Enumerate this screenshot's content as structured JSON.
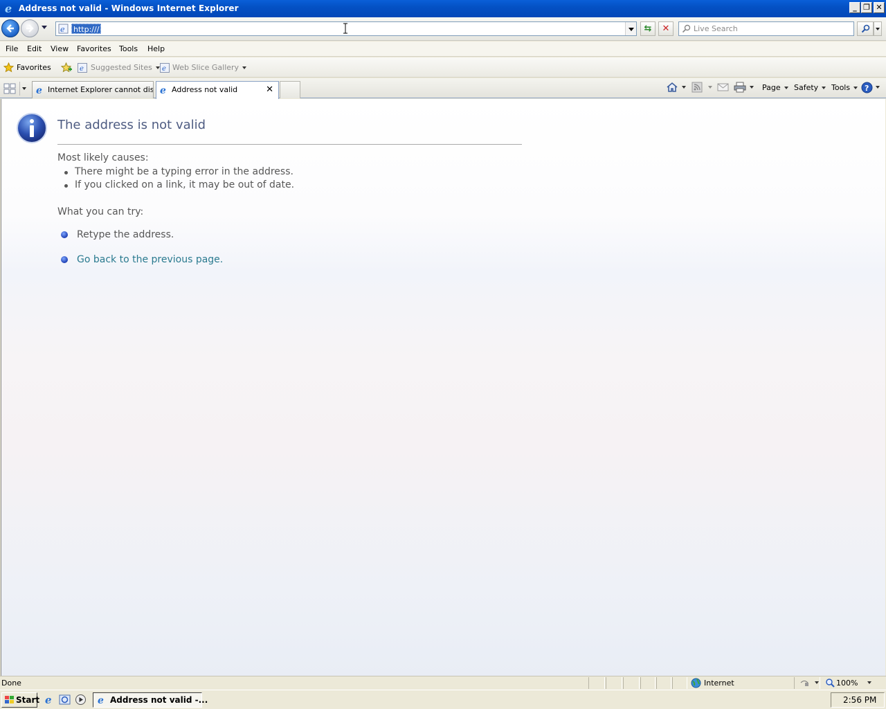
{
  "window": {
    "title": "Address not valid - Windows Internet Explorer"
  },
  "address_bar": {
    "url": "http:///",
    "search_placeholder": "Live Search"
  },
  "menu": [
    "File",
    "Edit",
    "View",
    "Favorites",
    "Tools",
    "Help"
  ],
  "favorites_bar": {
    "favorites_label": "Favorites",
    "suggested_sites": "Suggested Sites",
    "web_slice_gallery": "Web Slice Gallery"
  },
  "tabs": [
    {
      "label": "Internet Explorer cannot dis...",
      "active": false
    },
    {
      "label": "Address not valid",
      "active": true
    }
  ],
  "command_bar": {
    "page": "Page",
    "safety": "Safety",
    "tools": "Tools"
  },
  "content": {
    "title": "The address is not valid",
    "causes_heading": "Most likely causes:",
    "causes": [
      "There might be a typing error in the address.",
      "If you clicked on a link, it may be out of date."
    ],
    "try_heading": "What you can try:",
    "retype": "Retype the address.",
    "go_back": "Go back to the previous page."
  },
  "status_bar": {
    "status": "Done",
    "zone": "Internet",
    "zoom": "100%"
  },
  "taskbar": {
    "start": "Start",
    "task_label": "Address not valid -...",
    "clock": "2:56 PM"
  },
  "colors": {
    "title_bar": "#0451c4",
    "page_title": "#4e5c82",
    "link": "#2a7a8f"
  }
}
